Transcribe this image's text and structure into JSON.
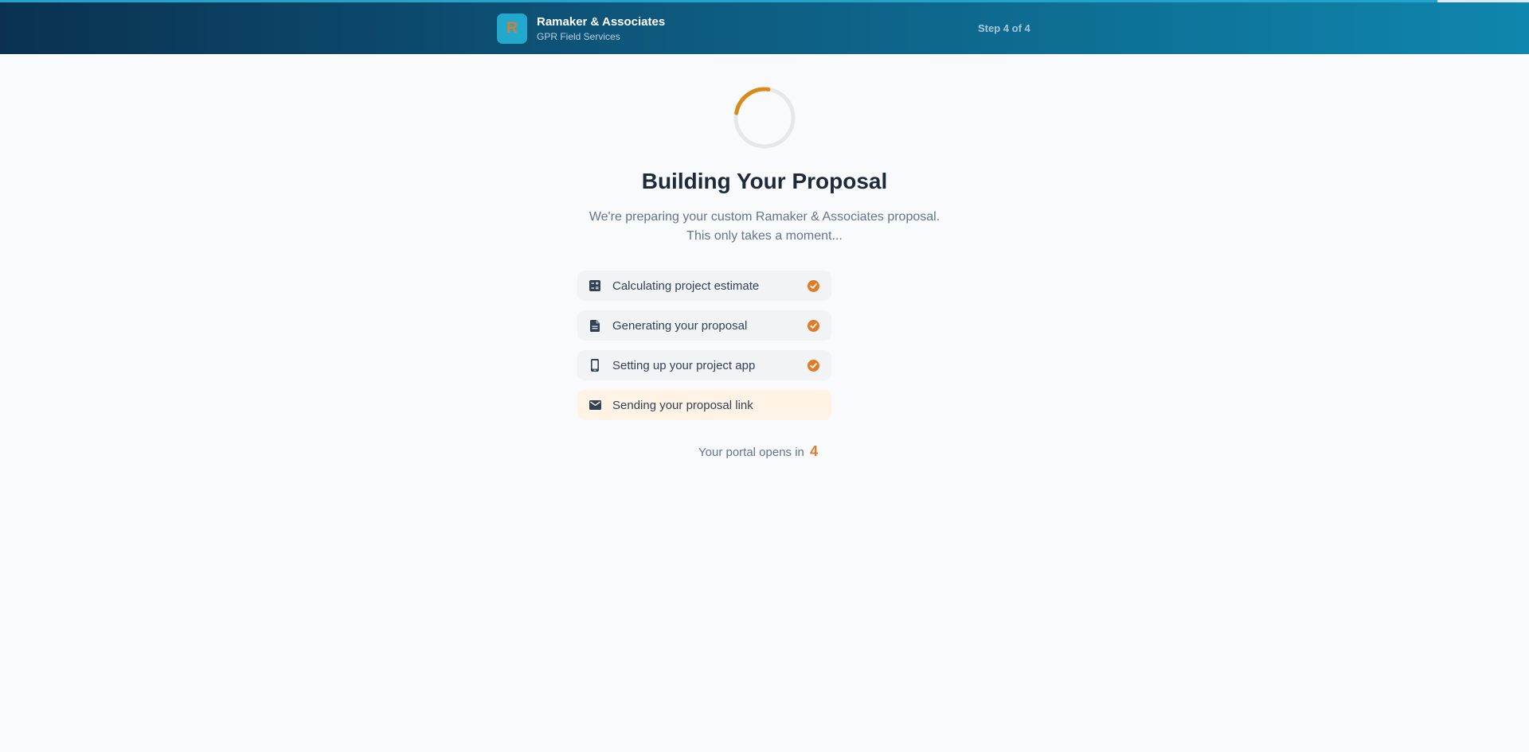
{
  "progress": {
    "value": 0.94
  },
  "header": {
    "logo_letter": "R",
    "brand_name": "Ramaker & Associates",
    "brand_subtitle": "GPR Field Services",
    "step_text": "Step 4 of 4"
  },
  "main": {
    "title": "Building Your Proposal",
    "subtitle_line1": "We're preparing your custom Ramaker & Associates proposal.",
    "subtitle_line2": "This only takes a moment..."
  },
  "steps": [
    {
      "label": "Calculating project estimate",
      "icon": "calculator-icon",
      "status": "done"
    },
    {
      "label": "Generating your proposal",
      "icon": "document-icon",
      "status": "done"
    },
    {
      "label": "Setting up your project app",
      "icon": "mobile-phone-icon",
      "status": "done"
    },
    {
      "label": "Sending your proposal link",
      "icon": "envelope-icon",
      "status": "in-progress"
    }
  ],
  "countdown": {
    "text": "Your portal opens in",
    "value": "4"
  },
  "colors": {
    "accent": "#e07b27",
    "header_dark": "#0a3151",
    "header_light": "#0f86ad",
    "progress": "#22a3c9",
    "active_step_bg": "#fff3e6"
  }
}
